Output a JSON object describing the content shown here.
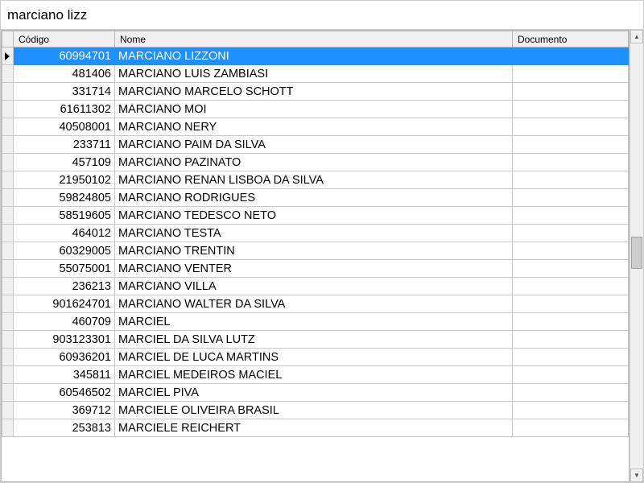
{
  "search": {
    "value": "marciano lizz"
  },
  "columns": {
    "codigo": "Código",
    "nome": "Nome",
    "documento": "Documento"
  },
  "selected_index": 0,
  "rows": [
    {
      "codigo": "60994701",
      "nome": "MARCIANO LIZZONI",
      "documento": ""
    },
    {
      "codigo": "481406",
      "nome": "MARCIANO LUIS ZAMBIASI",
      "documento": ""
    },
    {
      "codigo": "331714",
      "nome": "MARCIANO MARCELO SCHOTT",
      "documento": ""
    },
    {
      "codigo": "61611302",
      "nome": "MARCIANO MOI",
      "documento": ""
    },
    {
      "codigo": "40508001",
      "nome": "MARCIANO NERY",
      "documento": ""
    },
    {
      "codigo": "233711",
      "nome": "MARCIANO PAIM DA SILVA",
      "documento": ""
    },
    {
      "codigo": "457109",
      "nome": "MARCIANO PAZINATO",
      "documento": ""
    },
    {
      "codigo": "21950102",
      "nome": "MARCIANO RENAN LISBOA DA SILVA",
      "documento": ""
    },
    {
      "codigo": "59824805",
      "nome": "MARCIANO RODRIGUES",
      "documento": ""
    },
    {
      "codigo": "58519605",
      "nome": "MARCIANO TEDESCO NETO",
      "documento": ""
    },
    {
      "codigo": "464012",
      "nome": "MARCIANO TESTA",
      "documento": ""
    },
    {
      "codigo": "60329005",
      "nome": "MARCIANO TRENTIN",
      "documento": ""
    },
    {
      "codigo": "55075001",
      "nome": "MARCIANO VENTER",
      "documento": ""
    },
    {
      "codigo": "236213",
      "nome": "MARCIANO VILLA",
      "documento": ""
    },
    {
      "codigo": "901624701",
      "nome": "MARCIANO WALTER DA SILVA",
      "documento": ""
    },
    {
      "codigo": "460709",
      "nome": "MARCIEL",
      "documento": ""
    },
    {
      "codigo": "903123301",
      "nome": "MARCIEL DA SILVA LUTZ",
      "documento": ""
    },
    {
      "codigo": "60936201",
      "nome": "MARCIEL DE LUCA MARTINS",
      "documento": ""
    },
    {
      "codigo": "345811",
      "nome": "MARCIEL MEDEIROS MACIEL",
      "documento": ""
    },
    {
      "codigo": "60546502",
      "nome": "MARCIEL PIVA",
      "documento": ""
    },
    {
      "codigo": "369712",
      "nome": "MARCIELE OLIVEIRA BRASIL",
      "documento": ""
    },
    {
      "codigo": "253813",
      "nome": "MARCIELE REICHERT",
      "documento": ""
    }
  ]
}
